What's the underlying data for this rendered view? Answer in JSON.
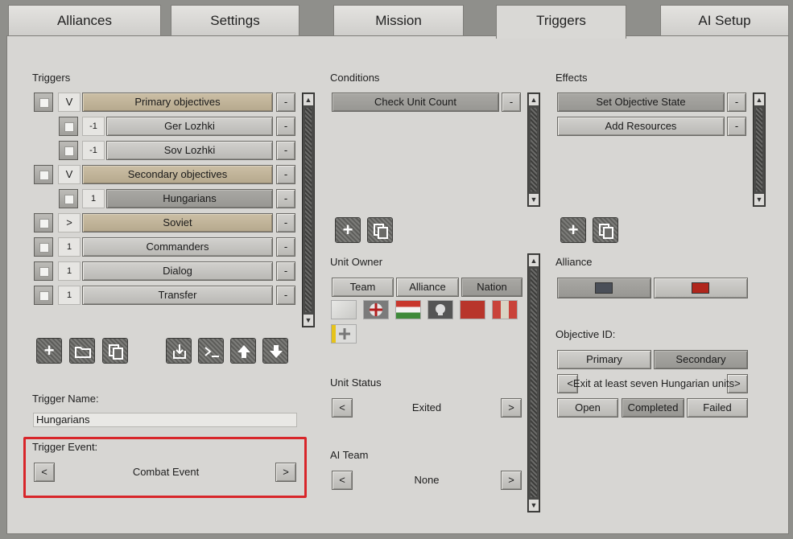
{
  "tabs": [
    {
      "label": "Alliances"
    },
    {
      "label": "Settings"
    },
    {
      "label": "Mission"
    },
    {
      "label": "Triggers"
    },
    {
      "label": "AI Setup"
    }
  ],
  "triggers": {
    "title": "Triggers",
    "items": [
      {
        "prefix": "V",
        "label": "Primary objectives"
      },
      {
        "prefix": "-1",
        "label": "Ger Lozhki"
      },
      {
        "prefix": "-1",
        "label": "Sov Lozhki"
      },
      {
        "prefix": "V",
        "label": "Secondary objectives"
      },
      {
        "prefix": "1",
        "label": "Hungarians"
      },
      {
        "prefix": ">",
        "label": "Soviet"
      },
      {
        "prefix": "1",
        "label": "Commanders"
      },
      {
        "prefix": "1",
        "label": "Dialog"
      },
      {
        "prefix": "1",
        "label": "Transfer"
      }
    ],
    "remove_label": "-"
  },
  "trigger_name": {
    "label": "Trigger Name:",
    "value": "Hungarians"
  },
  "trigger_event": {
    "label": "Trigger Event:",
    "value": "Combat Event",
    "prev": "<",
    "next": ">"
  },
  "conditions": {
    "title": "Conditions",
    "items": [
      {
        "label": "Check Unit Count"
      }
    ]
  },
  "effects": {
    "title": "Effects",
    "items": [
      {
        "label": "Set Objective State"
      },
      {
        "label": "Add Resources"
      }
    ]
  },
  "unit_owner": {
    "label": "Unit Owner",
    "buttons": [
      "Team",
      "Alliance",
      "Nation"
    ]
  },
  "unit_status": {
    "label": "Unit Status",
    "value": "Exited",
    "prev": "<",
    "next": ">"
  },
  "ai_team": {
    "label": "AI Team",
    "value": "None",
    "prev": "<",
    "next": ">"
  },
  "alliance": {
    "label": "Alliance",
    "colors": [
      "#4a4f58",
      "#b0261c"
    ]
  },
  "objective": {
    "label": "Objective ID:",
    "type_buttons": [
      "Primary",
      "Secondary"
    ],
    "selector": {
      "prev": "<",
      "value": "Exit at least seven Hungarian units",
      "next": ">"
    },
    "state_buttons": [
      "Open",
      "Completed",
      "Failed"
    ]
  },
  "icons": {
    "add": "plus-icon",
    "folder": "folder-icon",
    "copy": "copy-icon",
    "import": "import-icon",
    "console": "console-icon",
    "up": "arrow-up-icon",
    "down": "arrow-down-icon"
  }
}
